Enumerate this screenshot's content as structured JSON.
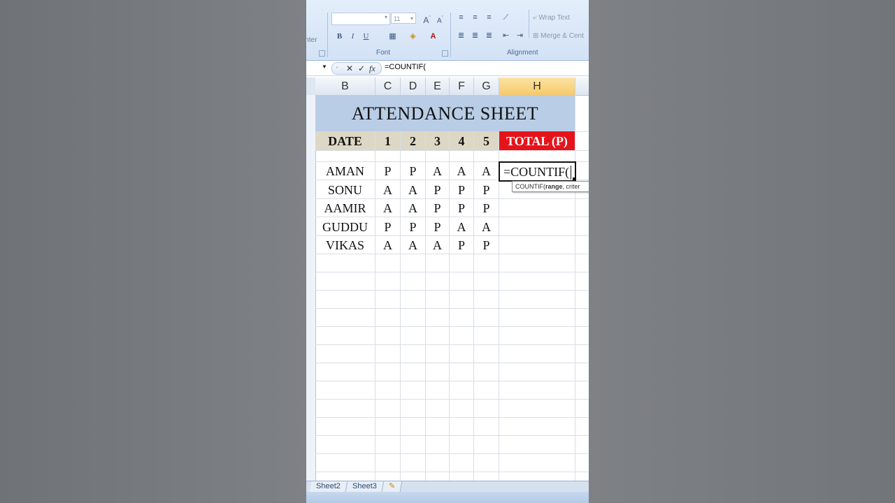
{
  "ribbon": {
    "painter_text": "inter",
    "font_name": "",
    "font_size": "11",
    "wrap_text": "Wrap Text",
    "merge_center": "Merge & Cent",
    "font_group": "Font",
    "alignment_group": "Alignment",
    "bold": "B",
    "italic": "I",
    "underline": "U"
  },
  "formula_bar": {
    "cancel": "✕",
    "enter": "✓",
    "fx": "fx",
    "formula": "=COUNTIF("
  },
  "columns": [
    "B",
    "C",
    "D",
    "E",
    "F",
    "G",
    "H"
  ],
  "sheet": {
    "title": "ATTENDANCE SHEET",
    "header": {
      "date": "DATE",
      "days": [
        "1",
        "2",
        "3",
        "4",
        "5"
      ],
      "total": "TOTAL (P)"
    },
    "rows": [
      {
        "name": "AMAN",
        "days": [
          "P",
          "P",
          "A",
          "A",
          "A"
        ]
      },
      {
        "name": "SONU",
        "days": [
          "A",
          "A",
          "P",
          "P",
          "P"
        ]
      },
      {
        "name": "AAMIR",
        "days": [
          "A",
          "A",
          "P",
          "P",
          "P"
        ]
      },
      {
        "name": "GUDDU",
        "days": [
          "P",
          "P",
          "P",
          "A",
          "A"
        ]
      },
      {
        "name": "VIKAS",
        "days": [
          "A",
          "A",
          "A",
          "P",
          "P"
        ]
      }
    ],
    "active_cell_text": "=COUNTIF(",
    "tooltip_fn": "COUNTIF(",
    "tooltip_arg": "range",
    "tooltip_rest": ", criter"
  },
  "tabs": [
    "Sheet2",
    "Sheet3"
  ],
  "colors": {
    "title_bg": "#b9cde6",
    "header_bg": "#ddd8c5",
    "total_bg": "#e5141b",
    "selected_col": "#f6c96b"
  }
}
